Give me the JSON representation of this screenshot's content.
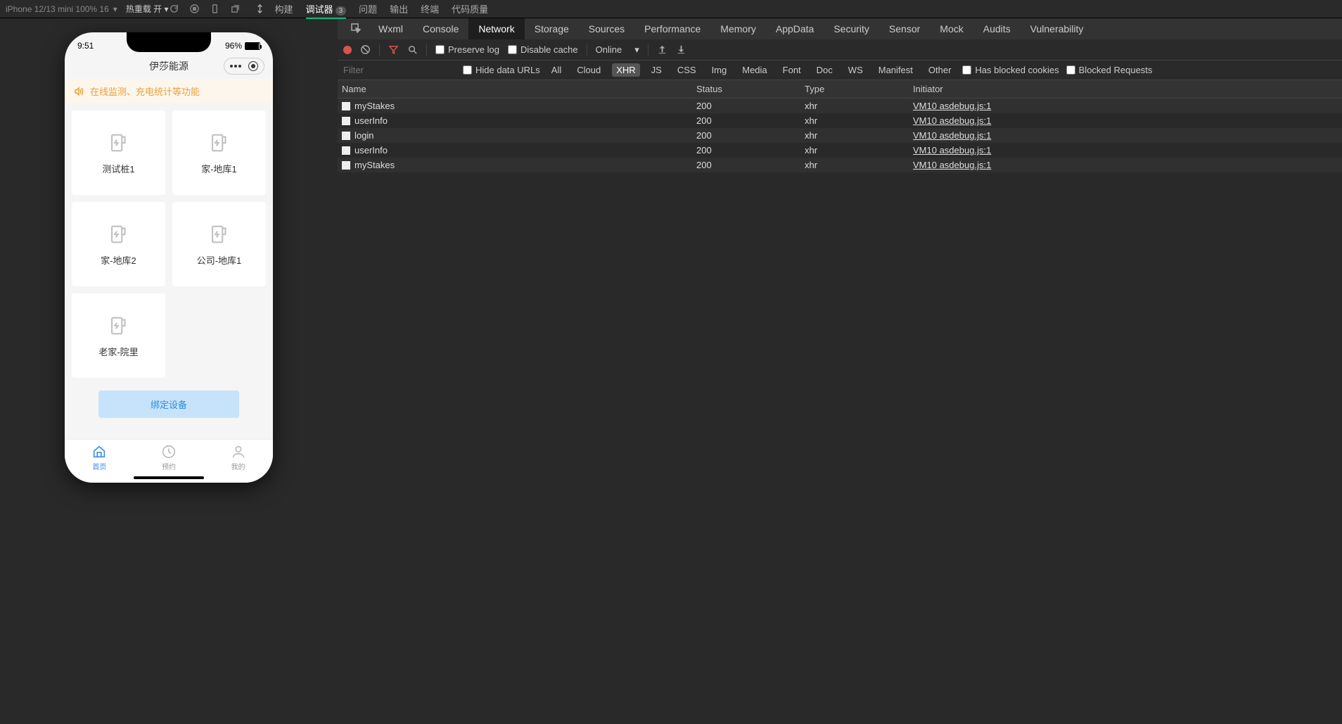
{
  "top": {
    "device": "iPhone 12/13 mini 100% 16",
    "hotReload": "热重载 开",
    "tabs": [
      "构建",
      "调试器",
      "问题",
      "输出",
      "终端",
      "代码质量"
    ],
    "activeTab": "调试器",
    "debugBadge": "3"
  },
  "sim": {
    "time": "9:51",
    "battery": "96%",
    "title": "伊莎能源",
    "notice": "在线监测、充电统计等功能",
    "devices": [
      "测试桩1",
      "家-地库1",
      "家-地库2",
      "公司-地库1",
      "老家-院里"
    ],
    "bindBtn": "绑定设备",
    "tabbar": [
      "首页",
      "预约",
      "我的"
    ]
  },
  "devtools": {
    "tabs": [
      "Wxml",
      "Console",
      "Network",
      "Storage",
      "Sources",
      "Performance",
      "Memory",
      "AppData",
      "Security",
      "Sensor",
      "Mock",
      "Audits",
      "Vulnerability"
    ],
    "activeTab": "Network",
    "preserveLog": "Preserve log",
    "disableCache": "Disable cache",
    "online": "Online",
    "filterPlaceholder": "Filter",
    "hideDataUrls": "Hide data URLs",
    "filters": [
      "All",
      "Cloud",
      "XHR",
      "JS",
      "CSS",
      "Img",
      "Media",
      "Font",
      "Doc",
      "WS",
      "Manifest",
      "Other"
    ],
    "activeFilter": "XHR",
    "hasBlockedCookies": "Has blocked cookies",
    "blockedRequests": "Blocked Requests",
    "columns": {
      "name": "Name",
      "status": "Status",
      "type": "Type",
      "initiator": "Initiator"
    },
    "rows": [
      {
        "name": "myStakes",
        "status": "200",
        "type": "xhr",
        "initiator": "VM10 asdebug.js:1"
      },
      {
        "name": "userInfo",
        "status": "200",
        "type": "xhr",
        "initiator": "VM10 asdebug.js:1"
      },
      {
        "name": "login",
        "status": "200",
        "type": "xhr",
        "initiator": "VM10 asdebug.js:1"
      },
      {
        "name": "userInfo",
        "status": "200",
        "type": "xhr",
        "initiator": "VM10 asdebug.js:1"
      },
      {
        "name": "myStakes",
        "status": "200",
        "type": "xhr",
        "initiator": "VM10 asdebug.js:1"
      }
    ]
  }
}
